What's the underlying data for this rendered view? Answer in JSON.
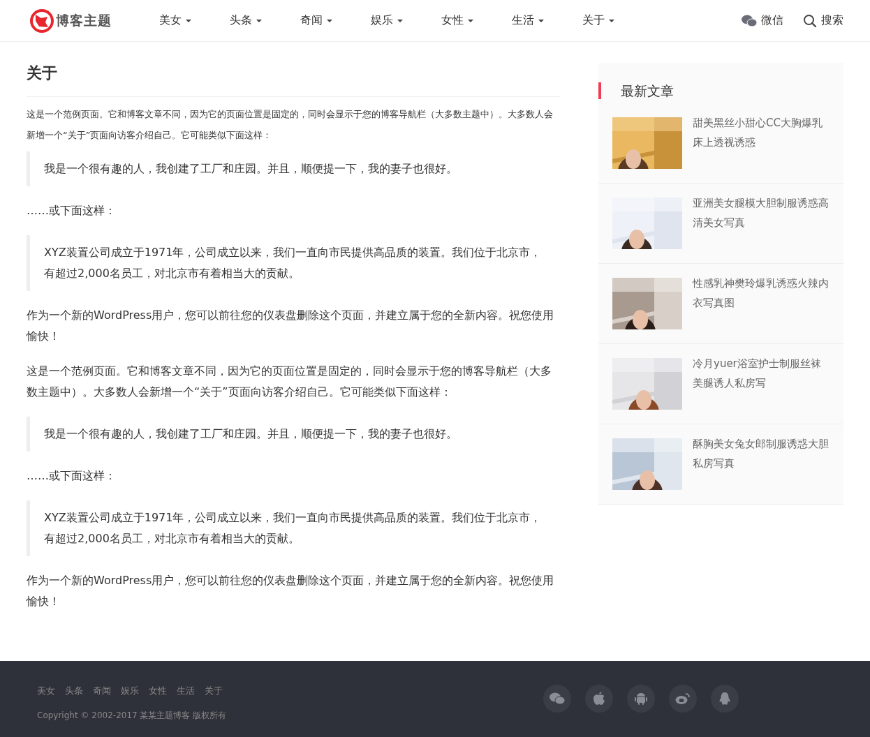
{
  "header": {
    "logo_text": "博客主题",
    "nav": [
      {
        "label": "美女"
      },
      {
        "label": "头条"
      },
      {
        "label": "奇闻"
      },
      {
        "label": "娱乐"
      },
      {
        "label": "女性"
      },
      {
        "label": "生活"
      },
      {
        "label": "关于"
      }
    ],
    "wechat": "微信",
    "search": "搜索"
  },
  "page": {
    "title": "关于",
    "blocks": [
      {
        "kind": "intro",
        "text": "这是一个范例页面。它和博客文章不同，因为它的页面位置是固定的，同时会显示于您的博客导航栏（大多数主题中）。大多数人会新增一个“关于”页面向访客介绍自己。它可能类似下面这样："
      },
      {
        "kind": "quote",
        "text": "我是一个很有趣的人，我创建了工厂和庄园。并且，顺便提一下，我的妻子也很好。"
      },
      {
        "kind": "paragraph",
        "text": "……或下面这样："
      },
      {
        "kind": "quote",
        "text": "XYZ装置公司成立于1971年，公司成立以来，我们一直向市民提供高品质的装置。我们位于北京市，有超过2,000名员工，对北京市有着相当大的贡献。"
      },
      {
        "kind": "paragraph",
        "text": "作为一个新的WordPress用户，您可以前往您的仪表盘删除这个页面，并建立属于您的全新内容。祝您使用愉快！"
      },
      {
        "kind": "paragraph",
        "text": "这是一个范例页面。它和博客文章不同，因为它的页面位置是固定的，同时会显示于您的博客导航栏（大多数主题中）。大多数人会新增一个“关于”页面向访客介绍自己。它可能类似下面这样："
      },
      {
        "kind": "quote",
        "text": "我是一个很有趣的人，我创建了工厂和庄园。并且，顺便提一下，我的妻子也很好。"
      },
      {
        "kind": "paragraph",
        "text": "……或下面这样："
      },
      {
        "kind": "quote",
        "text": "XYZ装置公司成立于1971年，公司成立以来，我们一直向市民提供高品质的装置。我们位于北京市，有超过2,000名员工，对北京市有着相当大的贡献。"
      },
      {
        "kind": "paragraph",
        "text": "作为一个新的WordPress用户，您可以前往您的仪表盘删除这个页面，并建立属于您的全新内容。祝您使用愉快！"
      }
    ]
  },
  "sidebar": {
    "title": "最新文章",
    "posts": [
      {
        "title": "甜美黑丝小甜心CC大胸爆乳床上透视诱惑"
      },
      {
        "title": "亚洲美女腿模大胆制服诱惑高清美女写真"
      },
      {
        "title": "性感乳神樊玲爆乳诱惑火辣内衣写真图"
      },
      {
        "title": "冷月yuer浴室护士制服丝袜美腿诱人私房写"
      },
      {
        "title": "酥胸美女兔女郎制服诱惑大胆私房写真"
      }
    ]
  },
  "footer": {
    "links": [
      "美女",
      "头条",
      "奇闻",
      "娱乐",
      "女性",
      "生活",
      "关于"
    ],
    "copyright": "Copyright © 2002-2017 某某主题博客 版权所有"
  }
}
